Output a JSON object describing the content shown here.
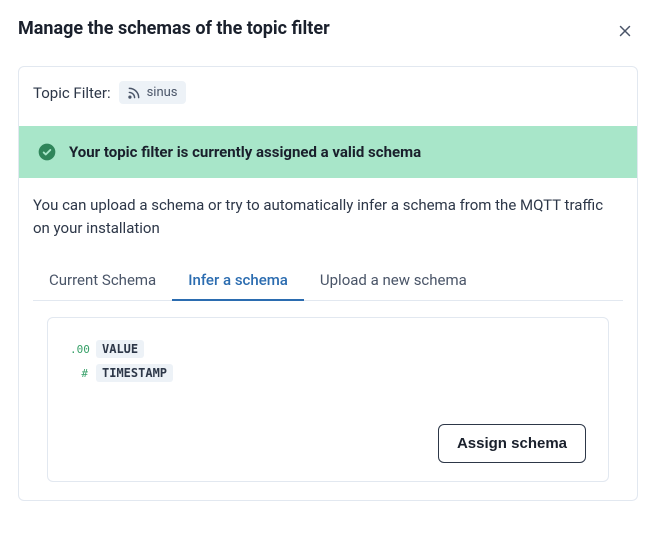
{
  "header": {
    "title": "Manage the schemas of the topic filter"
  },
  "topicFilter": {
    "label": "Topic Filter:",
    "value": "sinus"
  },
  "alert": {
    "message": "Your topic filter is currently assigned a valid schema"
  },
  "description": "You can upload a schema or try to automatically infer a schema from the MQTT traffic on your installation",
  "tabs": {
    "current": "Current Schema",
    "infer": "Infer a schema",
    "upload": "Upload a new schema"
  },
  "fields": [
    {
      "type": ".00",
      "name": "VALUE"
    },
    {
      "type": "#",
      "name": "TIMESTAMP"
    }
  ],
  "actions": {
    "assign": "Assign schema"
  }
}
